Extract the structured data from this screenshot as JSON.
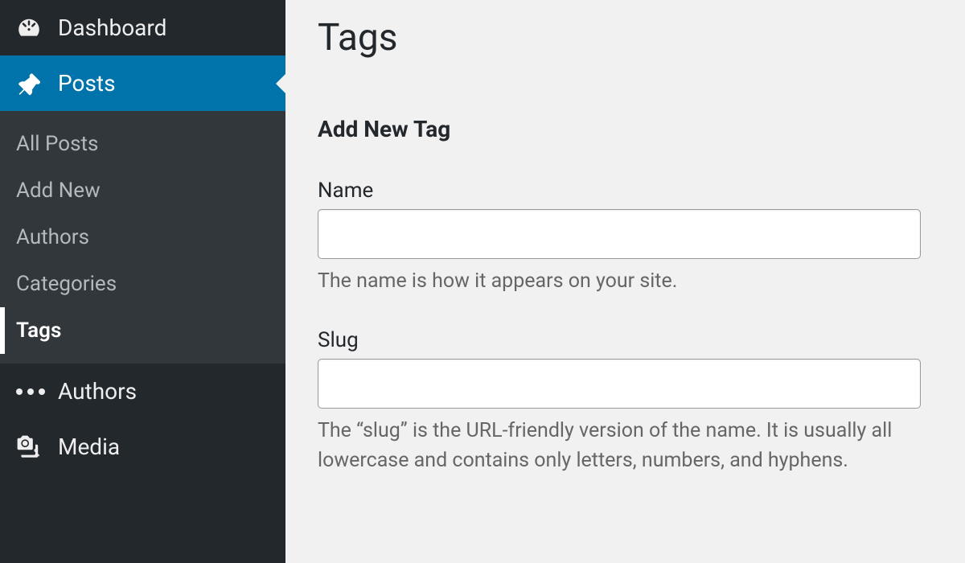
{
  "sidebar": {
    "dashboard": {
      "label": "Dashboard"
    },
    "posts": {
      "label": "Posts",
      "submenu": {
        "all_posts": "All Posts",
        "add_new": "Add New",
        "authors": "Authors",
        "categories": "Categories",
        "tags": "Tags"
      }
    },
    "authors": {
      "label": "Authors"
    },
    "media": {
      "label": "Media"
    }
  },
  "main": {
    "page_title": "Tags",
    "section_title": "Add New Tag",
    "fields": {
      "name": {
        "label": "Name",
        "value": "",
        "help": "The name is how it appears on your site."
      },
      "slug": {
        "label": "Slug",
        "value": "",
        "help": "The “slug” is the URL-friendly version of the name. It is usually all lowercase and contains only letters, numbers, and hyphens."
      }
    }
  }
}
